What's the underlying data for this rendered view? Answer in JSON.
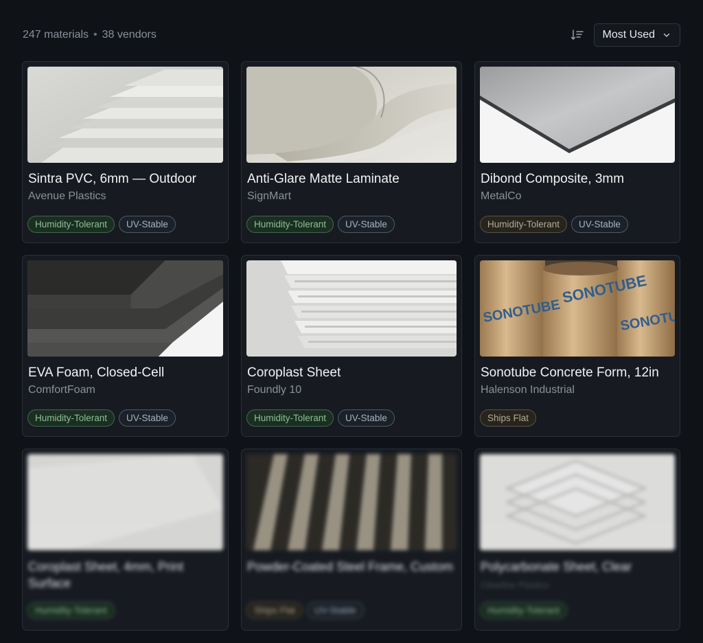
{
  "summary": {
    "materials": "247 materials",
    "separator": "•",
    "vendors": "38 vendors"
  },
  "sort": {
    "icon": "sort-icon",
    "selected": "Most Used"
  },
  "cards": [
    {
      "title": "Sintra PVC, 6mm — Outdoor",
      "vendor": "Avenue Plastics",
      "tags": [
        "Humidity-Tolerant",
        "UV-Stable"
      ]
    },
    {
      "title": "Anti-Glare Matte Laminate",
      "vendor": "SignMart",
      "tags": [
        "Humidity-Tolerant",
        "UV-Stable"
      ]
    },
    {
      "title": "Dibond Composite, 3mm",
      "vendor": "MetalCo",
      "tags": [
        "Humidity-Tolerant",
        "UV-Stable"
      ]
    },
    {
      "title": "EVA Foam, Closed-Cell",
      "vendor": "ComfortFoam",
      "tags": [
        "Humidity-Tolerant",
        "UV-Stable"
      ]
    },
    {
      "title": "Coroplast Sheet",
      "vendor": "Foundly 10",
      "tags": [
        "Humidity-Tolerant",
        "UV-Stable"
      ]
    },
    {
      "title": "Sonotube Concrete Form, 12in",
      "vendor": "Halenson Industrial",
      "tags": [
        "Ships Flat"
      ],
      "image_text": "SONOTUBE"
    },
    {
      "title": "Coroplast Sheet, 4mm, Print Surface",
      "vendor": "",
      "tags": [
        "Humidity-Tolerant"
      ]
    },
    {
      "title": "Powder-Coated Steel Frame, Custom",
      "vendor": "",
      "tags": [
        "Ships Flat",
        "UV-Stable"
      ]
    },
    {
      "title": "Polycarbonate Sheet, Clear",
      "vendor": "Clearline Plastics",
      "tags": [
        "Humidity-Tolerant"
      ]
    }
  ],
  "colors": {
    "background": "#0f1318",
    "card": "#171b21",
    "tag_green": "#8fbf98",
    "tag_blue": "#a9b3c0",
    "tag_amber": "#b5ab96"
  }
}
